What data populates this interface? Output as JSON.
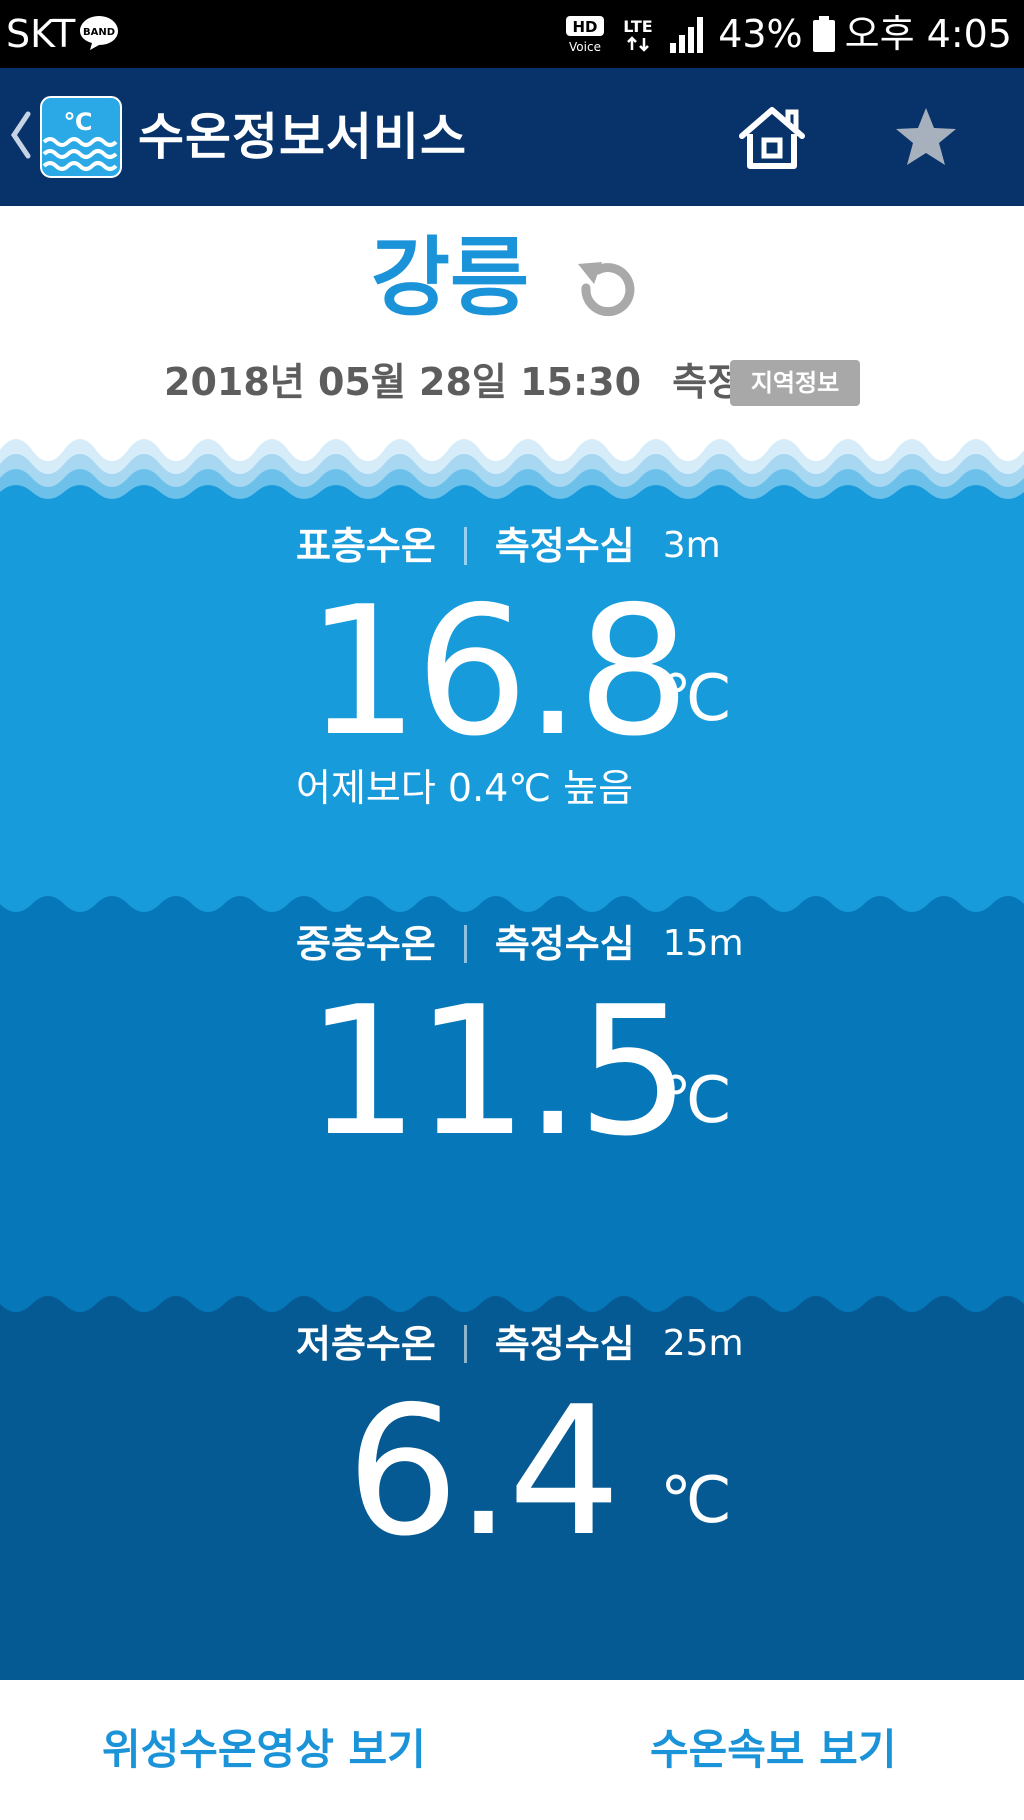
{
  "status_bar": {
    "carrier": "SKT",
    "band_badge": "BAND",
    "hd_label": "HD",
    "voice_label": "Voice",
    "network": "LTE",
    "battery": "43%",
    "time": "오후 4:05"
  },
  "app_bar": {
    "logo_unit": "℃",
    "title": "수온정보서비스",
    "icons": {
      "back": "chevron-left-icon",
      "home": "home-icon",
      "favorite": "star-icon"
    }
  },
  "header": {
    "location": "강릉",
    "measured_at": "2018년 05월 28일 15:30",
    "measured_suffix": "측정",
    "region_badge": "지역정보"
  },
  "layers": [
    {
      "name": "표층수온",
      "depth_label": "측정수심",
      "depth": "3m",
      "temp": "16.8",
      "unit": "℃",
      "compare": "어제보다 0.4℃ 높음"
    },
    {
      "name": "중층수온",
      "depth_label": "측정수심",
      "depth": "15m",
      "temp": "11.5",
      "unit": "℃"
    },
    {
      "name": "저층수온",
      "depth_label": "측정수심",
      "depth": "25m",
      "temp": "6.4",
      "unit": "℃"
    }
  ],
  "bottom_links": {
    "satellite": "위성수온영상 보기",
    "alert": "수온속보 보기"
  },
  "colors": {
    "app_bar": "#08336a",
    "accent": "#1a93d8",
    "surface": "#189bdb",
    "middle": "#0678b9",
    "bottom": "#065a93",
    "badge": "#a8a8a8"
  }
}
